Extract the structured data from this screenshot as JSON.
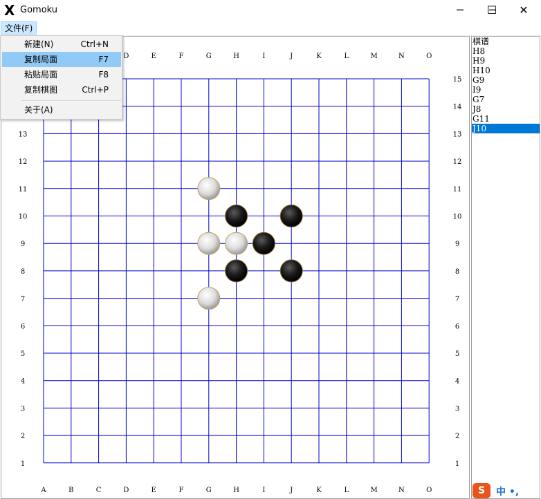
{
  "window": {
    "title": "Gomoku",
    "app_icon": "X",
    "minimize": "─",
    "maximize": "☐",
    "close": "✕"
  },
  "menubar": {
    "file_label": "文件(F)"
  },
  "file_menu": {
    "items": [
      {
        "label": "新建(N)",
        "shortcut": "Ctrl+N"
      },
      {
        "label": "复制局面",
        "shortcut": "F7"
      },
      {
        "label": "粘贴局面",
        "shortcut": "F8"
      },
      {
        "label": "复制棋图",
        "shortcut": "Ctrl+P"
      },
      {
        "label": "关于(A)",
        "shortcut": ""
      }
    ],
    "highlighted_index": 1
  },
  "board": {
    "columns": [
      "A",
      "B",
      "C",
      "D",
      "E",
      "F",
      "G",
      "H",
      "I",
      "J",
      "K",
      "L",
      "M",
      "N",
      "O"
    ],
    "rows": [
      "1",
      "2",
      "3",
      "4",
      "5",
      "6",
      "7",
      "8",
      "9",
      "10",
      "11",
      "12",
      "13",
      "14",
      "15"
    ],
    "top_column_labels": [
      "D",
      "E",
      "F",
      "G",
      "H",
      "I",
      "J",
      "K",
      "L",
      "M",
      "N",
      "O"
    ],
    "left_row_labels": [
      "1",
      "2",
      "3",
      "4",
      "5",
      "6",
      "7",
      "8",
      "9",
      "10",
      "11",
      "12",
      "13"
    ],
    "line_color": "#0000cc",
    "stones": [
      {
        "col": "H",
        "row": 8,
        "color": "black"
      },
      {
        "col": "H",
        "row": 9,
        "color": "white"
      },
      {
        "col": "H",
        "row": 10,
        "color": "black"
      },
      {
        "col": "G",
        "row": 9,
        "color": "white"
      },
      {
        "col": "G",
        "row": 7,
        "color": "white"
      },
      {
        "col": "I",
        "row": 9,
        "color": "black"
      },
      {
        "col": "J",
        "row": 8,
        "color": "black"
      },
      {
        "col": "G",
        "row": 11,
        "color": "white"
      },
      {
        "col": "J",
        "row": 10,
        "color": "black"
      }
    ]
  },
  "record": {
    "header": "棋谱",
    "moves": [
      "H8",
      "H9",
      "H10",
      "G9",
      "I9",
      "G7",
      "J8",
      "G11",
      "J10"
    ],
    "selected_index": 9
  },
  "ime": {
    "logo": "S",
    "text": "中 •,"
  },
  "colors": {
    "menu_highlight": "#91c9f7",
    "list_selection": "#0078d7",
    "ime_logo": "#e8541e"
  }
}
